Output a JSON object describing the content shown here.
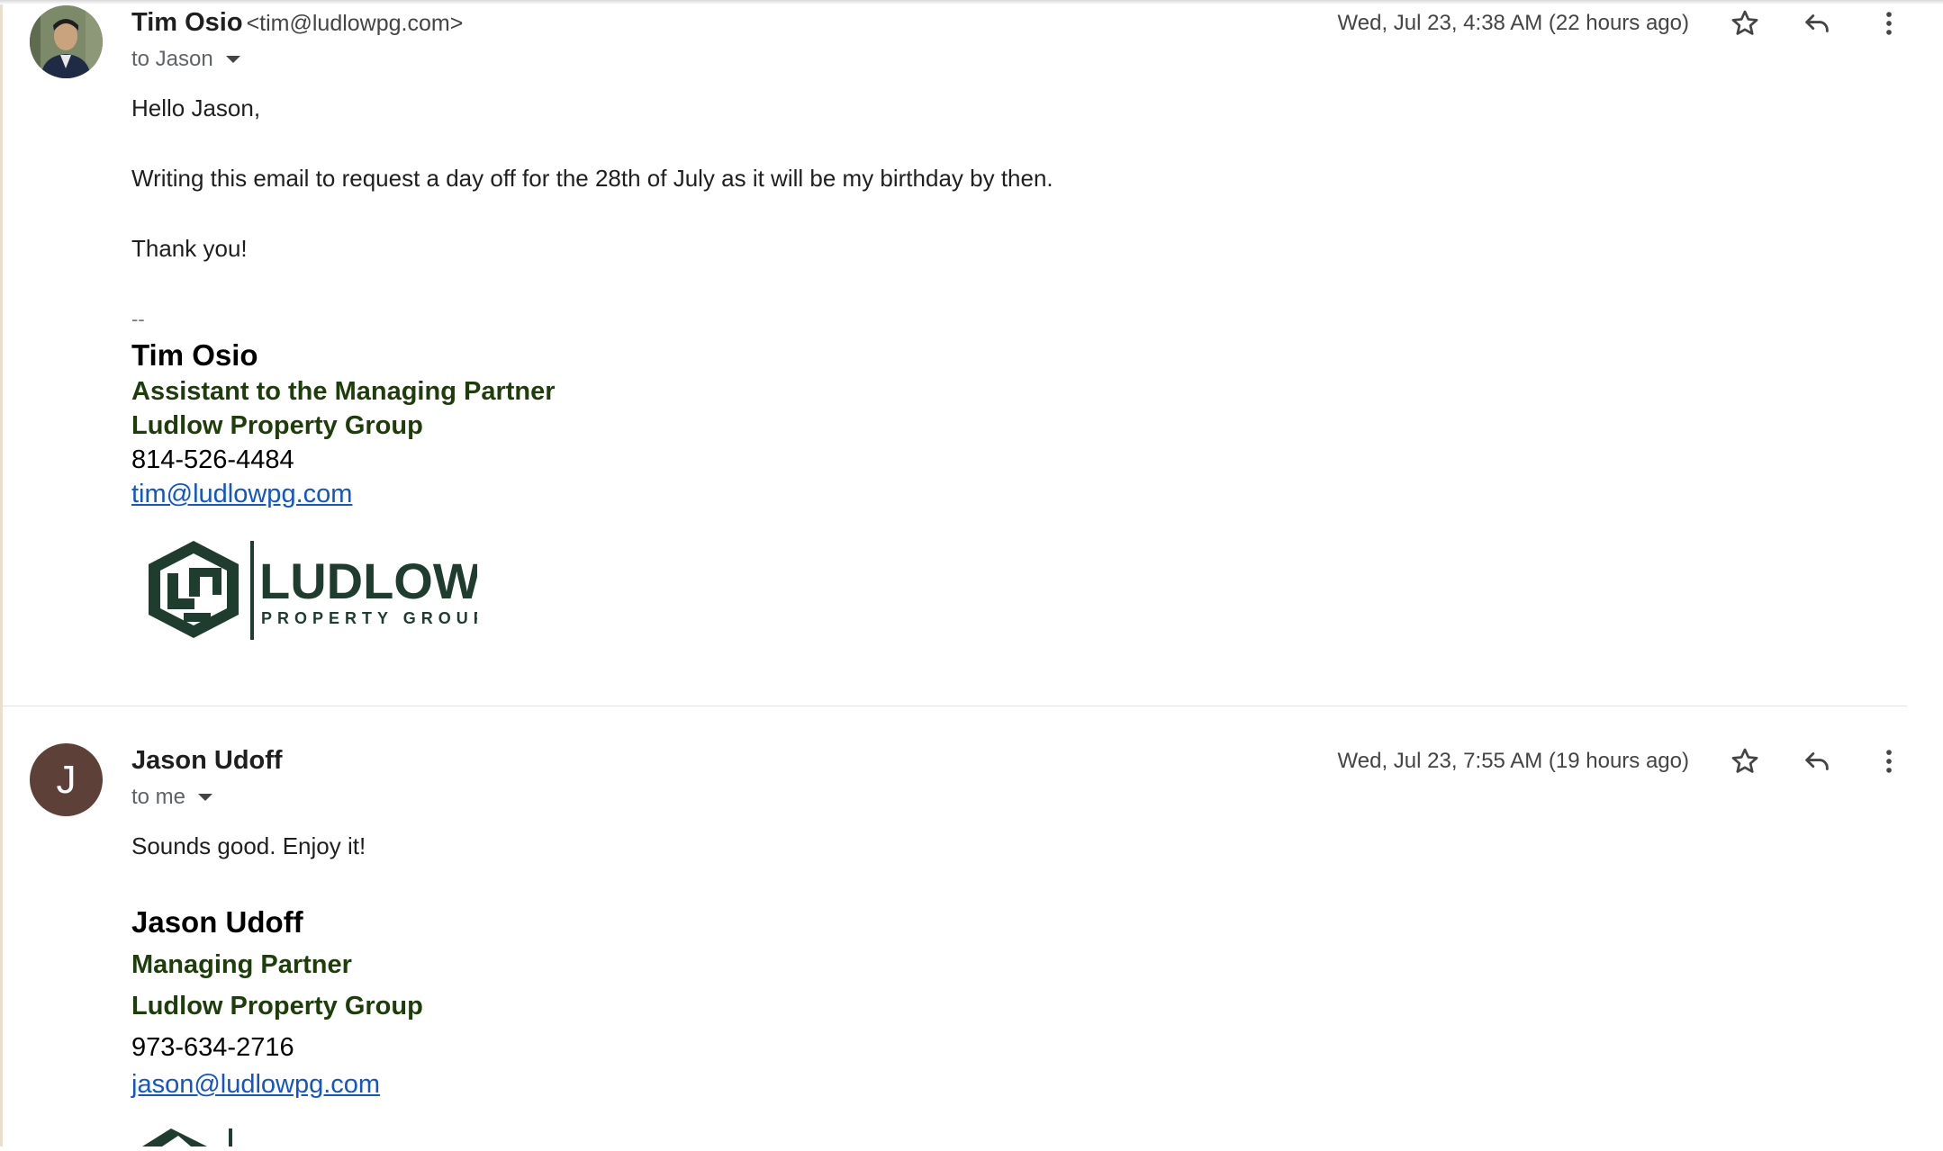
{
  "messages": [
    {
      "sender_name": "Tim Osio",
      "sender_email": "<tim@ludlowpg.com>",
      "recipient": "to Jason",
      "date": "Wed, Jul 23, 4:38 AM (22 hours ago)",
      "body": [
        "Hello Jason,",
        "Writing this email to request a day off for the 28th of July  as it will be my birthday by then.",
        "Thank you!"
      ],
      "sig_separator": "--",
      "signature": {
        "name": "Tim Osio",
        "title": "Assistant to the Managing Partner",
        "company": "Ludlow Property Group",
        "phone": "814-526-4484",
        "email": "tim@ludlowpg.com"
      },
      "logo": {
        "word": "LUDLOW",
        "tagline": "PROPERTY GROUP"
      }
    },
    {
      "avatar_letter": "J",
      "avatar_color": "#5d4037",
      "sender_name": "Jason Udoff",
      "recipient": "to me",
      "date": "Wed, Jul 23, 7:55 AM (19 hours ago)",
      "body": [
        "Sounds good. Enjoy it!"
      ],
      "signature": {
        "name": "Jason Udoff",
        "title": "Managing Partner",
        "company": "Ludlow Property Group",
        "phone": "973-634-2716",
        "email": "jason@ludlowpg.com"
      }
    }
  ],
  "icons": [
    "star-icon",
    "reply-icon",
    "more-vert-icon"
  ],
  "colors": {
    "signature_green": "#1d3d0a",
    "link_blue": "#1155cc",
    "logo_green": "#1f3d2f"
  }
}
